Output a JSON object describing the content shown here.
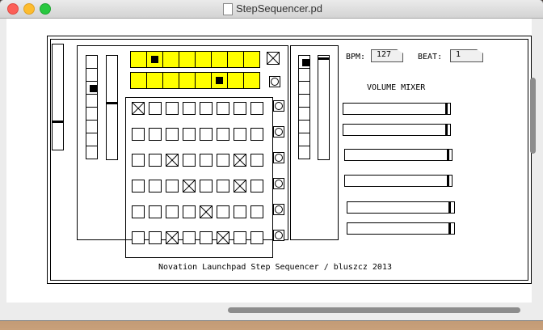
{
  "window": {
    "title": "StepSequencer.pd"
  },
  "patch": {
    "bpm_label": "BPM:",
    "bpm_value": "127",
    "beat_label": "BEAT:",
    "beat_value": "1",
    "mixer_title": "VOLUME MIXER",
    "footer": "Novation Launchpad Step Sequencer / bluszcz 2013"
  },
  "top_rows": [
    {
      "lit_step": 1
    },
    {
      "lit_step": 5
    }
  ],
  "grid_rows": [
    {
      "on": [
        0
      ]
    },
    {
      "on": []
    },
    {
      "on": [
        2,
        6
      ]
    },
    {
      "on": [
        3,
        6
      ]
    },
    {
      "on": [
        4
      ]
    },
    {
      "on": [
        2,
        5
      ]
    }
  ],
  "mixer": [
    {
      "level": 0.98
    },
    {
      "level": 0.98
    },
    {
      "level": 0.98
    },
    {
      "level": 0.98
    },
    {
      "level": 0.97
    },
    {
      "level": 0.97
    }
  ],
  "colors": {
    "step_bg": "#ffff00",
    "background": "#ffffff"
  }
}
